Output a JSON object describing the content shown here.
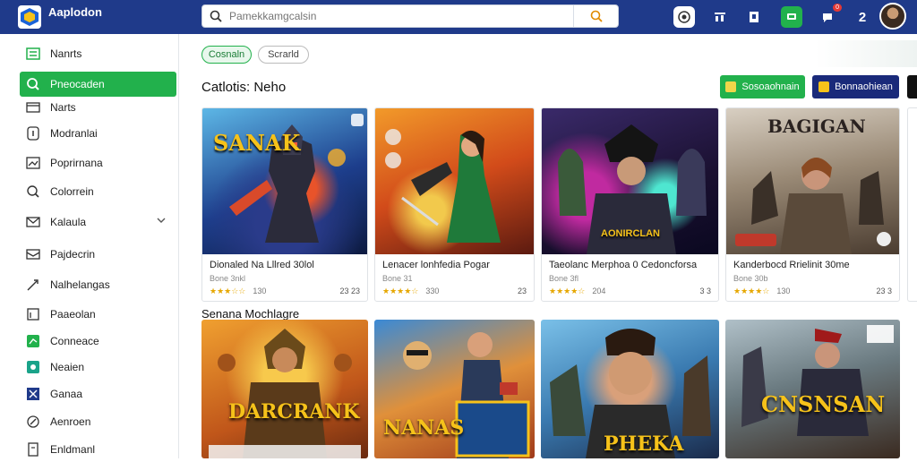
{
  "brand": {
    "name": "Aaplodon",
    "tagline": ""
  },
  "search": {
    "placeholder": "Pamekkamgcalsin"
  },
  "topbar": {
    "notify_badge": "0",
    "counter": "2"
  },
  "sidebar": {
    "items": [
      {
        "label": "Nanrts",
        "icon": "list-icon"
      },
      {
        "label": "Pneocaden",
        "icon": "search-icon"
      },
      {
        "label": "Narts",
        "icon": "window-icon"
      },
      {
        "label": "Modranlai",
        "icon": "info-icon"
      },
      {
        "label": "Poprirnana",
        "icon": "image-icon"
      },
      {
        "label": "Colorrein",
        "icon": "magnifier-icon"
      },
      {
        "label": "Kalaula",
        "icon": "mail-icon"
      },
      {
        "label": "Pajdecrin",
        "icon": "inbox-icon"
      },
      {
        "label": "Nalhelangas",
        "icon": "tag-icon"
      },
      {
        "label": "Paaeolan",
        "icon": "book-icon"
      },
      {
        "label": "Conneace",
        "icon": "green-square-icon"
      },
      {
        "label": "Neaien",
        "icon": "teal-square-icon"
      },
      {
        "label": "Ganaa",
        "icon": "grid-icon"
      },
      {
        "label": "Aenroen",
        "icon": "compass-icon"
      },
      {
        "label": "Enldmanl",
        "icon": "document-icon"
      }
    ]
  },
  "filters": {
    "chip1": "Cosnaln",
    "chip2": "Scrarld"
  },
  "section1": {
    "title": "Catlotis: Neho"
  },
  "actions": {
    "btn1": "Sosoaohnain",
    "btn2": "Bonnaohiean"
  },
  "cards": [
    {
      "art_title": "SANAK",
      "art_sub": "",
      "title": "Dionaled Na Lllred 30lol",
      "sub": "Bone 3nkl",
      "stars": "★★★☆☆",
      "rating": "130",
      "stat": "23 23"
    },
    {
      "art_title": "",
      "art_sub": "",
      "title": "Lenacer lonhfedia Pogar",
      "sub": "Bone 31",
      "stars": "★★★★☆",
      "rating": "330",
      "stat": "23"
    },
    {
      "art_title": "",
      "art_sub": "AONIRCLAN",
      "title": "Taeolanc Merphoa 0 Cedoncforsa",
      "sub": "Bone 3fl",
      "stars": "★★★★☆",
      "rating": "204",
      "stat": "3 3"
    },
    {
      "art_title": "BAGIGAN",
      "art_sub": "",
      "title": "Kanderbocd Rrielinit 30me",
      "sub": "Bone 30b",
      "stars": "★★★★☆",
      "rating": "130",
      "stat": "23 3"
    }
  ],
  "section2": {
    "title": "Senana Mochlagre"
  },
  "cards2": [
    {
      "art_title": "DARCRANK"
    },
    {
      "art_title": "NANAS"
    },
    {
      "art_title": "PHEKA"
    },
    {
      "art_title": "CNSNSAN"
    }
  ],
  "colors": {
    "topbar": "#1f3a8a",
    "accent": "#22b14c",
    "btn_blue": "#1a2a7a"
  }
}
